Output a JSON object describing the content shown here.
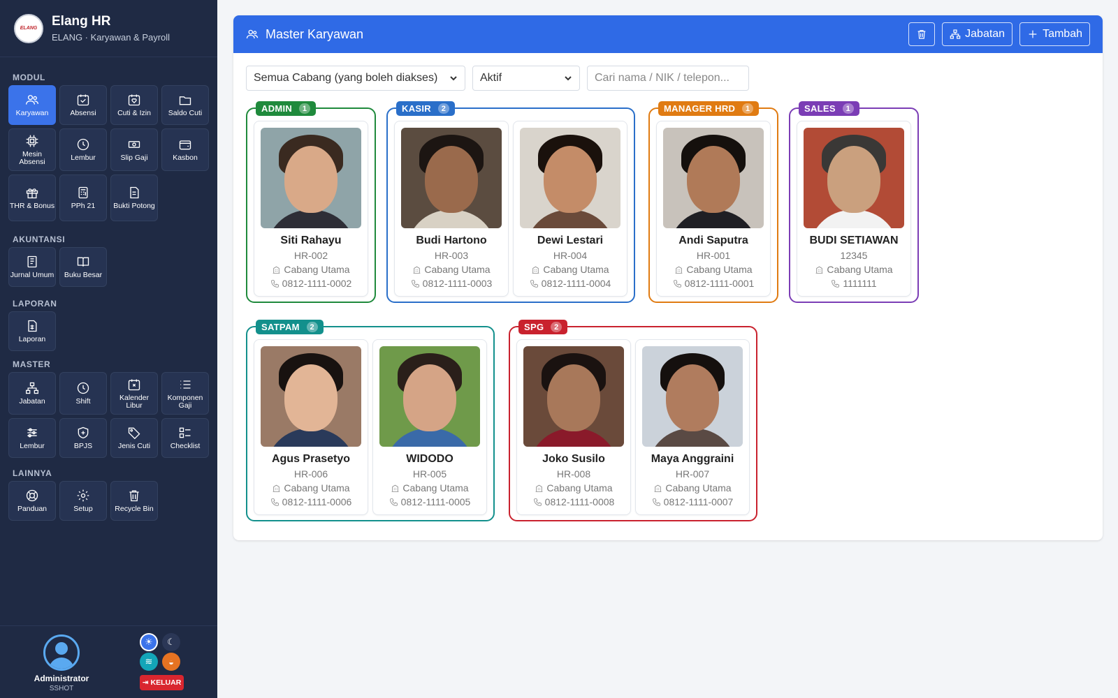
{
  "app": {
    "title": "Elang HR",
    "subtitle": "ELANG · Karyawan & Payroll",
    "logo_text": "ELANG"
  },
  "sidebar": {
    "sections": [
      {
        "label": "MODUL",
        "items": [
          {
            "label": "Karyawan",
            "icon": "users-icon",
            "active": true
          },
          {
            "label": "Absensi",
            "icon": "calendar-check-icon"
          },
          {
            "label": "Cuti & Izin",
            "icon": "calendar-heart-icon"
          },
          {
            "label": "Saldo Cuti",
            "icon": "folder-icon"
          },
          {
            "label": "Mesin Absensi",
            "icon": "chip-icon"
          },
          {
            "label": "Lembur",
            "icon": "clock-icon"
          },
          {
            "label": "Slip Gaji",
            "icon": "cash-icon"
          },
          {
            "label": "Kasbon",
            "icon": "wallet-icon"
          },
          {
            "label": "THR & Bonus",
            "icon": "gift-icon"
          },
          {
            "label": "PPh 21",
            "icon": "calculator-icon"
          },
          {
            "label": "Bukti Potong",
            "icon": "document-icon"
          }
        ]
      },
      {
        "label": "AKUNTANSI",
        "items": [
          {
            "label": "Jurnal Umum",
            "icon": "journal-icon"
          },
          {
            "label": "Buku Besar",
            "icon": "book-icon"
          }
        ]
      },
      {
        "label": "LAPORAN",
        "items": [
          {
            "label": "Laporan",
            "icon": "report-icon"
          }
        ]
      },
      {
        "label": "MASTER",
        "items": [
          {
            "label": "Jabatan",
            "icon": "org-chart-icon"
          },
          {
            "label": "Shift",
            "icon": "clock-icon"
          },
          {
            "label": "Kalender Libur",
            "icon": "calendar-x-icon"
          },
          {
            "label": "Komponen Gaji",
            "icon": "list-icon"
          },
          {
            "label": "Lembur",
            "icon": "sliders-icon"
          },
          {
            "label": "BPJS",
            "icon": "shield-icon"
          },
          {
            "label": "Jenis Cuti",
            "icon": "tag-icon"
          },
          {
            "label": "Checklist",
            "icon": "checklist-icon"
          }
        ]
      },
      {
        "label": "LAINNYA",
        "items": [
          {
            "label": "Panduan",
            "icon": "lifebuoy-icon"
          },
          {
            "label": "Setup",
            "icon": "gear-icon"
          },
          {
            "label": "Recycle Bin",
            "icon": "trash-icon"
          }
        ]
      }
    ],
    "user": {
      "name": "Administrator",
      "role": "SSHOT"
    },
    "logout_label": "KELUAR"
  },
  "main": {
    "title": "Master Karyawan",
    "actions": {
      "jabatan": "Jabatan",
      "tambah": "Tambah"
    },
    "filters": {
      "branch": "Semua Cabang (yang boleh diakses)",
      "status": "Aktif",
      "search_placeholder": "Cari nama / NIK / telepon..."
    },
    "groups": [
      {
        "name": "ADMIN",
        "count": "1",
        "color": "#1f8a3c",
        "employees": [
          {
            "name": "Siti Rahayu",
            "id": "HR-002",
            "branch": "Cabang Utama",
            "phone": "0812-1111-0002"
          }
        ]
      },
      {
        "name": "KASIR",
        "count": "2",
        "color": "#2a6fc9",
        "employees": [
          {
            "name": "Budi Hartono",
            "id": "HR-003",
            "branch": "Cabang Utama",
            "phone": "0812-1111-0003"
          },
          {
            "name": "Dewi Lestari",
            "id": "HR-004",
            "branch": "Cabang Utama",
            "phone": "0812-1111-0004"
          }
        ]
      },
      {
        "name": "MANAGER HRD",
        "count": "1",
        "color": "#e07b12",
        "employees": [
          {
            "name": "Andi Saputra",
            "id": "HR-001",
            "branch": "Cabang Utama",
            "phone": "0812-1111-0001"
          }
        ]
      },
      {
        "name": "SALES",
        "count": "1",
        "color": "#7b3db5",
        "employees": [
          {
            "name": "BUDI SETIAWAN",
            "id": "12345",
            "branch": "Cabang Utama",
            "phone": "1111111"
          }
        ]
      },
      {
        "name": "SATPAM",
        "count": "2",
        "color": "#13908c",
        "employees": [
          {
            "name": "Agus Prasetyo",
            "id": "HR-006",
            "branch": "Cabang Utama",
            "phone": "0812-1111-0006"
          },
          {
            "name": "WIDODO",
            "id": "HR-005",
            "branch": "Cabang Utama",
            "phone": "0812-1111-0005"
          }
        ]
      },
      {
        "name": "SPG",
        "count": "2",
        "color": "#c9222e",
        "employees": [
          {
            "name": "Joko Susilo",
            "id": "HR-008",
            "branch": "Cabang Utama",
            "phone": "0812-1111-0008"
          },
          {
            "name": "Maya Anggraini",
            "id": "HR-007",
            "branch": "Cabang Utama",
            "phone": "0812-1111-0007"
          }
        ]
      }
    ]
  }
}
